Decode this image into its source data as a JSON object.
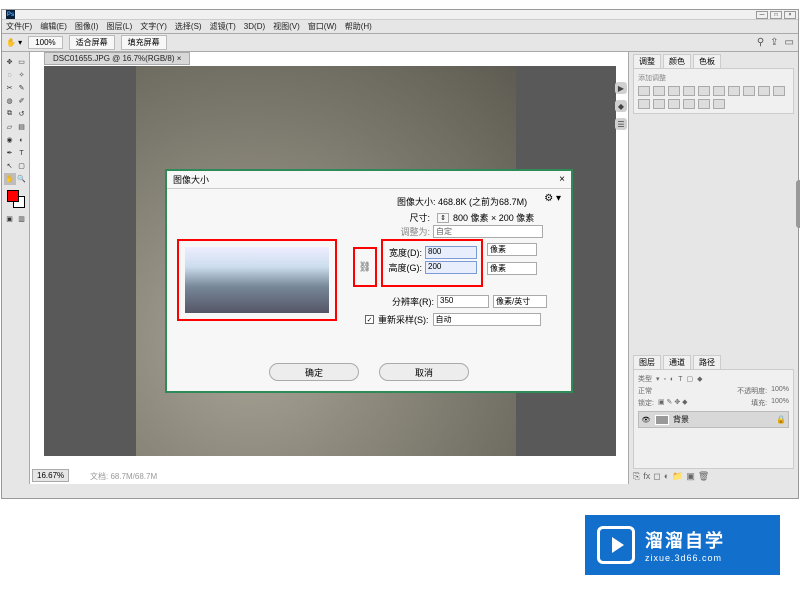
{
  "menubar": [
    "文件(F)",
    "编辑(E)",
    "图像(I)",
    "图层(L)",
    "文字(Y)",
    "选择(S)",
    "滤镜(T)",
    "3D(D)",
    "视图(V)",
    "窗口(W)",
    "帮助(H)"
  ],
  "optbar": {
    "zoom_pct": "100%",
    "fit1": "适合屏幕",
    "fit2": "填充屏幕"
  },
  "doc_tab": "DSC01655.JPG @ 16.7%(RGB/8) ×",
  "zoom_readout": "16.67%",
  "status_text": "文档: 68.7M/68.7M",
  "panels": {
    "adjust_tabs": [
      "调整",
      "颜色",
      "色板"
    ],
    "adjust_hint": "添加调整",
    "layers_tabs": [
      "图层",
      "通道",
      "路径"
    ],
    "layer_mode": "正常",
    "opacity_label": "不透明度:",
    "opacity_val": "100%",
    "lock_label": "锁定:",
    "fill_label": "填充:",
    "fill_val": "100%",
    "layer_name": "背景",
    "filter_label": "类型"
  },
  "dialog": {
    "title": "图像大小",
    "size_label": "图像大小:",
    "size_value": "468.8K (之前为68.7M)",
    "dim_label": "尺寸:",
    "dim_value": "800 像素 × 200 像素",
    "fit_label": "调整为:",
    "fit_value": "自定",
    "width_label": "宽度(D):",
    "width_value": "800",
    "height_label": "高度(G):",
    "height_value": "200",
    "unit_px": "像素",
    "res_label": "分辨率(R):",
    "res_value": "350",
    "res_unit": "像素/英寸",
    "resample_label": "重新采样(S):",
    "resample_value": "自动",
    "ok": "确定",
    "cancel": "取消"
  },
  "brand": {
    "title": "溜溜自学",
    "url": "zixue.3d66.com"
  }
}
